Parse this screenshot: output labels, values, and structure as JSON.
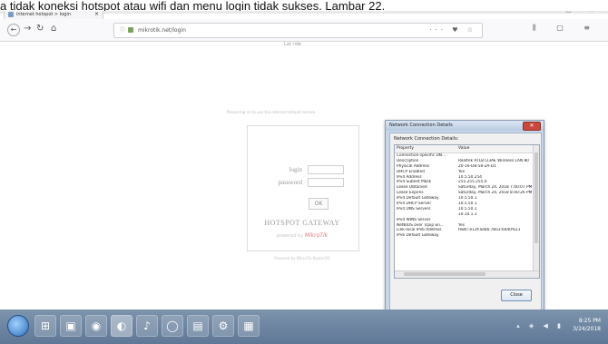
{
  "caption": "a tidak koneksi hotspot atau wifi dan menu login tidak sukses. Lambar 22.",
  "browser": {
    "tab_title": "internet hotspot > login",
    "tab_close": "×",
    "window_controls": "— ▢ ✕",
    "url": "mikrotik.net/login",
    "url_actions": "··· ♥ ☆",
    "right_tools": "⫼ ▢ ≡"
  },
  "login": {
    "lang": "Lat ride",
    "note": "Please log on to use the internet hotspot service",
    "login_label": "login",
    "password_label": "password",
    "ok_button": "OK",
    "gateway_title": "HOTSPOT GATEWAY",
    "powered_prefix": "powered by",
    "brand": "MikroTik",
    "footer": "Powered by MikroTik RouterOS"
  },
  "dialog": {
    "title": "Network Connection Details",
    "heading": "Network Connection Details:",
    "columns": [
      "Property",
      "Value"
    ],
    "rows": [
      [
        "Connection-specific DN...",
        ""
      ],
      [
        "Description",
        "Realtek RTL8723AE Wireless LAN 80"
      ],
      [
        "Physical Address",
        "20-16-D8-58-2A-D1"
      ],
      [
        "DHCP Enabled",
        "Yes"
      ],
      [
        "IPv4 Address",
        "10.5.50.254"
      ],
      [
        "IPv4 Subnet Mask",
        "255.255.255.0"
      ],
      [
        "Lease Obtained",
        "Saturday, March 24, 2018 7:40:07 PM"
      ],
      [
        "Lease Expires",
        "Saturday, March 24, 2018 8:40:26 PM"
      ],
      [
        "IPv4 Default Gateway",
        "10.5.50.1"
      ],
      [
        "IPv4 DHCP Server",
        "10.5.50.1"
      ],
      [
        "IPv4 DNS Servers",
        "10.5.50.1"
      ],
      [
        "",
        "10.10.1.1"
      ],
      [
        "IPv4 WINS Server",
        ""
      ],
      [
        "NetBIOS over Tcpip En...",
        "Yes"
      ],
      [
        "Link-local IPv6 Address",
        "fe80::e13f:aeb6:7b03:6440%11"
      ],
      [
        "IPv6 Default Gateway",
        ""
      ]
    ],
    "close_button": "Close"
  },
  "taskbar": {
    "apps": [
      "⊞",
      "▣",
      "◉",
      "◐",
      "♪",
      "◯",
      "▤",
      "⚙",
      "▦"
    ],
    "time": "8:25 PM",
    "date": "3/24/2018",
    "tray_icons": "▴ ◈ ◀ ▮"
  }
}
